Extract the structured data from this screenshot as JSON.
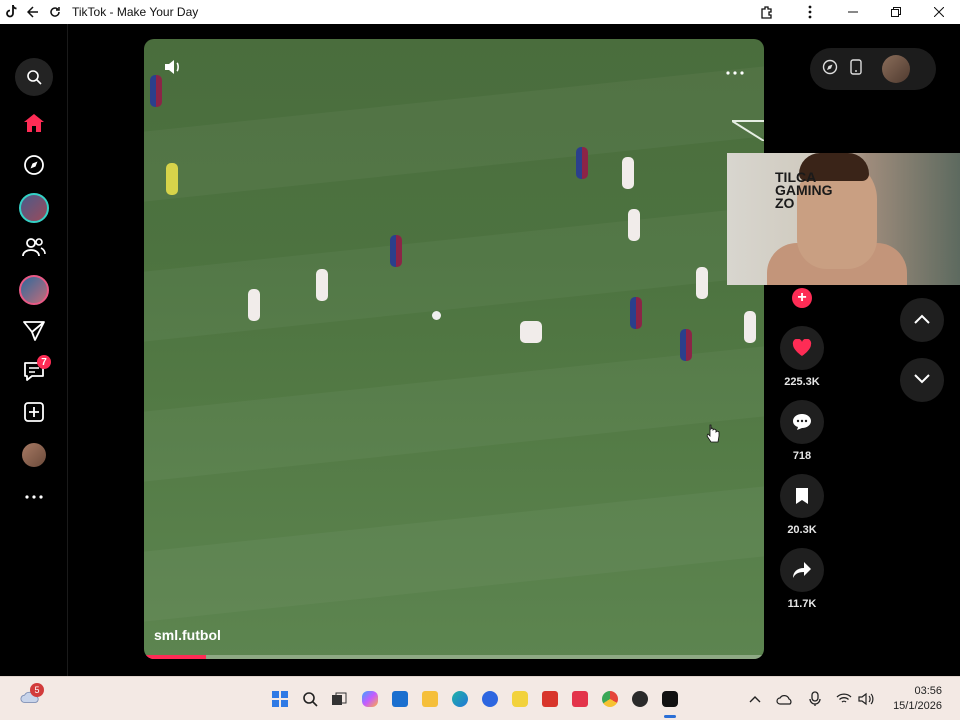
{
  "window": {
    "title": "TikTok - Make Your Day"
  },
  "sidebar": {
    "items": [
      {
        "name": "search-icon"
      },
      {
        "name": "home-icon"
      },
      {
        "name": "explore-icon"
      },
      {
        "name": "following-avatar"
      },
      {
        "name": "friends-icon"
      },
      {
        "name": "live-avatar"
      },
      {
        "name": "messages-icon"
      },
      {
        "name": "inbox-icon",
        "badge": "7"
      },
      {
        "name": "upload-icon"
      },
      {
        "name": "profile-avatar"
      },
      {
        "name": "more-icon"
      }
    ],
    "accent": "#fe2c55"
  },
  "video": {
    "username": "sml.futbol",
    "progress": 0.1
  },
  "actions": {
    "likes": "225.3K",
    "comments": "718",
    "saves": "20.3K",
    "shares": "11.7K"
  },
  "webcam": {
    "sign_text": "TILCA\nGAMING\nZO"
  },
  "taskbar": {
    "weather_badge": "5",
    "time": "03:56",
    "date": "15/1/2026"
  }
}
